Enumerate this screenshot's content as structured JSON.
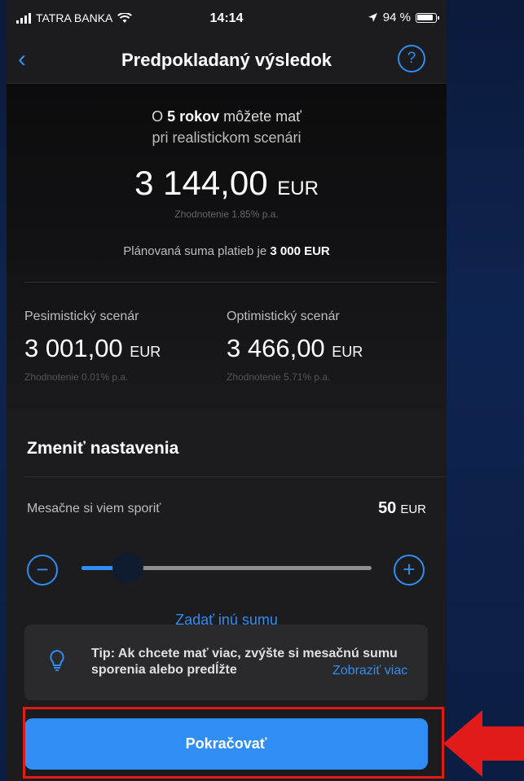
{
  "status": {
    "carrier": "TATRA BANKA",
    "time": "14:14",
    "battery": "94 %"
  },
  "nav": {
    "title": "Predpokladaný výsledok",
    "back": "‹",
    "help": "?"
  },
  "result": {
    "intro_pre": "O ",
    "intro_bold": "5 rokov",
    "intro_post": " môžete mať",
    "intro_line2": "pri realistickom scenári",
    "amount": "3 144,00",
    "currency": "EUR",
    "appreciation": "Zhodnotenie 1.85% p.a.",
    "planned_pre": "Plánovaná suma platieb je ",
    "planned_bold": "3 000 EUR"
  },
  "scenarios": [
    {
      "label": "Pesimistický scenár",
      "amount": "3 001,00",
      "currency": "EUR",
      "appreciation": "Zhodnotenie 0.01% p.a."
    },
    {
      "label": "Optimistický scenár",
      "amount": "3 466,00",
      "currency": "EUR",
      "appreciation": "Zhodnotenie 5.71% p.a."
    }
  ],
  "settings": {
    "title": "Zmeniť nastavenia",
    "monthly_label": "Mesačne si viem sporiť",
    "monthly_value": "50",
    "monthly_currency": "EUR",
    "slider_fraction": 0.16,
    "minus": "−",
    "plus": "+",
    "other_sum": "Zadať inú sumu"
  },
  "tip": {
    "text": "Tip: Ak chcete mať viac, zvýšte si mesačnú sumu sporenia alebo predĺžte",
    "more": "Zobraziť viac"
  },
  "continue_label": "Pokračovať",
  "colors": {
    "accent": "#2f8df3",
    "highlight": "#e11a1a"
  }
}
